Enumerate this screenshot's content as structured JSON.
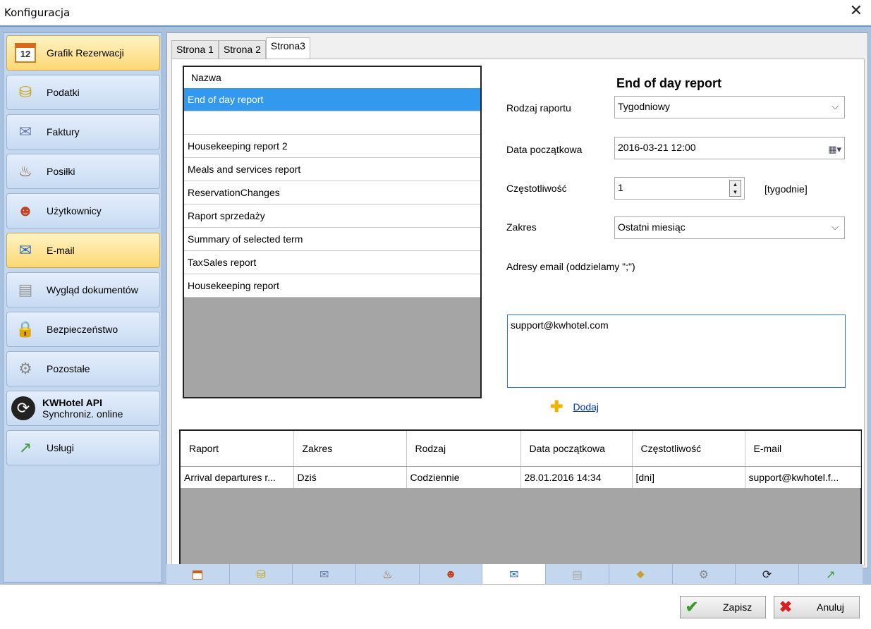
{
  "window": {
    "title": "Konfiguracja"
  },
  "sidebar": {
    "items": [
      {
        "label": "Grafik Rezerwacji",
        "icon": "calendar-icon",
        "glyph": "12"
      },
      {
        "label": "Podatki",
        "icon": "coins-icon",
        "glyph": "⛁"
      },
      {
        "label": "Faktury",
        "icon": "invoice-icon",
        "glyph": "✉"
      },
      {
        "label": "Posiłki",
        "icon": "meal-icon",
        "glyph": "♨"
      },
      {
        "label": "Użytkownicy",
        "icon": "users-icon",
        "glyph": "☻"
      },
      {
        "label": "E-mail",
        "icon": "email-icon",
        "glyph": "✉"
      },
      {
        "label": "Wygląd dokumentów",
        "icon": "document-icon",
        "glyph": "▤"
      },
      {
        "label": "Bezpieczeństwo",
        "icon": "padlock-icon",
        "glyph": "🔒"
      },
      {
        "label": "Pozostałe",
        "icon": "gears-icon",
        "glyph": "⚙"
      },
      {
        "label": "KWHotel API",
        "sublabel": "Synchroniz. online",
        "icon": "sync-icon",
        "glyph": "⟳"
      },
      {
        "label": "Usługi",
        "icon": "chart-icon",
        "glyph": "↗"
      }
    ]
  },
  "tabs": [
    "Strona 1",
    "Strona 2",
    "Strona3"
  ],
  "report_list": {
    "header": "Nazwa",
    "rows": [
      "End of day report",
      "",
      "Housekeeping report 2",
      "Meals and services report",
      "ReservationChanges",
      "Raport sprzedaży",
      "Summary of selected term",
      "TaxSales report",
      "Housekeeping report"
    ]
  },
  "form": {
    "title": "End of day report",
    "report_type_label": "Rodzaj raportu",
    "report_type_value": "Tygodniowy",
    "start_date_label": "Data początkowa",
    "start_date_value": "2016-03-21 12:00",
    "frequency_label": "Częstotliwość",
    "frequency_value": "1",
    "frequency_unit": "[tygodnie]",
    "range_label": "Zakres",
    "range_value": "Ostatni miesiąc",
    "emails_label": "Adresy email (oddzielamy \";\")",
    "emails_value": "support@kwhotel.com",
    "add_label": "Dodaj"
  },
  "schedule_table": {
    "columns": [
      "Raport",
      "Zakres",
      "Rodzaj",
      "Data początkowa",
      "Częstotliwość",
      "E-mail"
    ],
    "rows": [
      [
        "Arrival departures r...",
        "Dziś",
        "Codziennie",
        "28.01.2016 14:34",
        "[dni]",
        "support@kwhotel.f..."
      ]
    ]
  },
  "footer": {
    "save_label": "Zapisz",
    "cancel_label": "Anuluj"
  }
}
